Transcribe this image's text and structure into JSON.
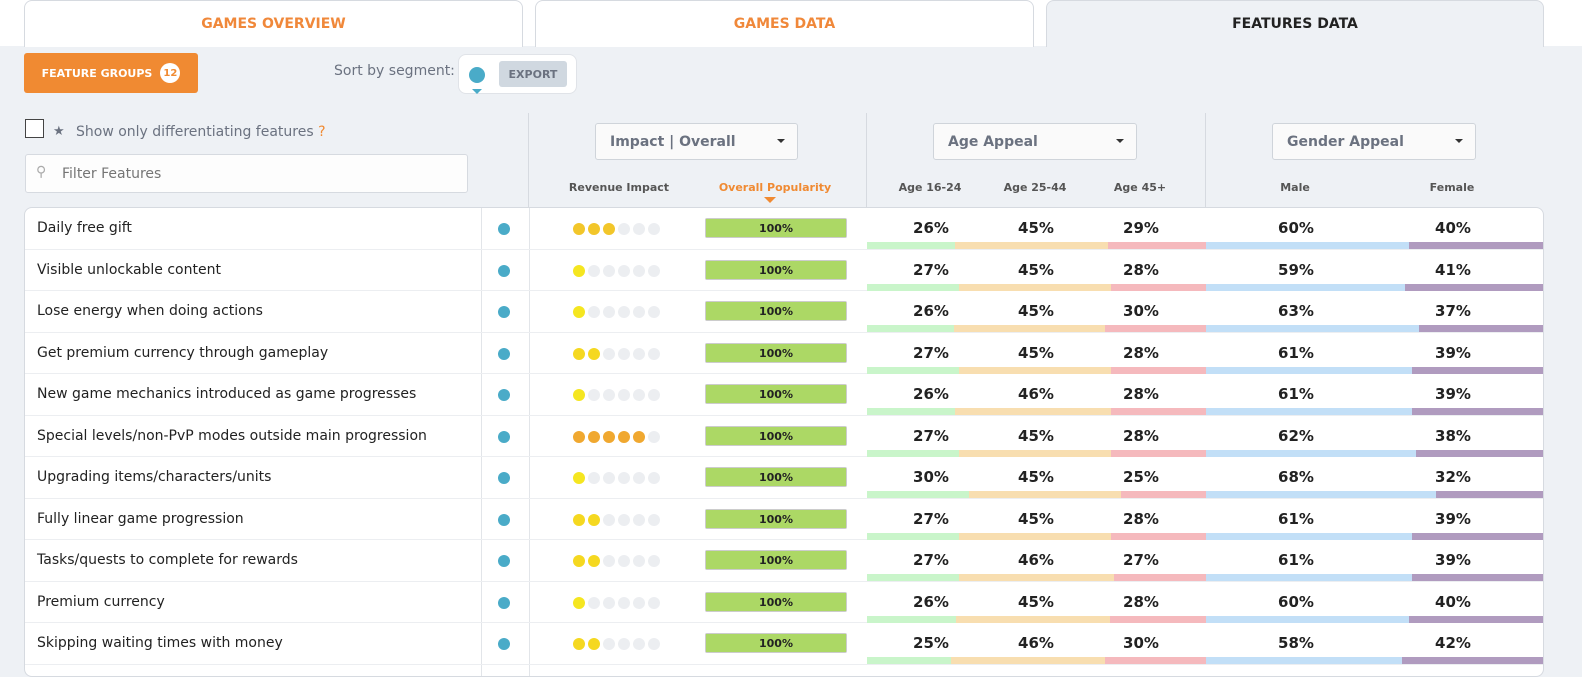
{
  "tabs": [
    {
      "label": "GAMES OVERVIEW"
    },
    {
      "label": "GAMES DATA"
    },
    {
      "label": "FEATURES DATA",
      "active": true
    }
  ],
  "toolbar": {
    "feature_groups_label": "FEATURE GROUPS",
    "feature_groups_count": "12",
    "sort_label": "Sort by segment:",
    "export_label": "EXPORT",
    "segment_color": "#4aabc8"
  },
  "filters": {
    "diff_label": "Show only differentiating features",
    "help": "?",
    "diff_checked": false,
    "search_placeholder": "Filter Features",
    "search_value": ""
  },
  "dropdowns": {
    "impact": "Impact | Overall",
    "age": "Age Appeal",
    "gender": "Gender Appeal"
  },
  "columns": {
    "revenue": "Revenue Impact",
    "popularity": "Overall Popularity",
    "age1": "Age 16-24",
    "age2": "Age 25-44",
    "age3": "Age 45+",
    "male": "Male",
    "female": "Female"
  },
  "colors": {
    "accent": "#f08a32",
    "popularity": "#acd865",
    "age1": "#c9f5ca",
    "age2": "#f8deb0",
    "age3": "#f5b9bd",
    "male": "#c2dff7",
    "female": "#b09bbf",
    "rev1": "#f5e620",
    "rev2": "#f5d820",
    "rev3": "#f2c62a",
    "rev5": "#f0a830"
  },
  "rows": [
    {
      "name": "Daily free gift",
      "revenue": 3,
      "popularity": "100%",
      "age": [
        "26%",
        "45%",
        "29%"
      ],
      "gender": [
        "60%",
        "40%"
      ]
    },
    {
      "name": "Visible unlockable content",
      "revenue": 1,
      "popularity": "100%",
      "age": [
        "27%",
        "45%",
        "28%"
      ],
      "gender": [
        "59%",
        "41%"
      ]
    },
    {
      "name": "Lose energy when doing actions",
      "revenue": 1,
      "popularity": "100%",
      "age": [
        "26%",
        "45%",
        "30%"
      ],
      "gender": [
        "63%",
        "37%"
      ]
    },
    {
      "name": "Get premium currency through gameplay",
      "revenue": 2,
      "popularity": "100%",
      "age": [
        "27%",
        "45%",
        "28%"
      ],
      "gender": [
        "61%",
        "39%"
      ]
    },
    {
      "name": "New game mechanics introduced as game progresses",
      "revenue": 1,
      "popularity": "100%",
      "age": [
        "26%",
        "46%",
        "28%"
      ],
      "gender": [
        "61%",
        "39%"
      ]
    },
    {
      "name": "Special levels/non-PvP modes outside main progression",
      "revenue": 5,
      "popularity": "100%",
      "age": [
        "27%",
        "45%",
        "28%"
      ],
      "gender": [
        "62%",
        "38%"
      ]
    },
    {
      "name": "Upgrading items/characters/units",
      "revenue": 1,
      "popularity": "100%",
      "age": [
        "30%",
        "45%",
        "25%"
      ],
      "gender": [
        "68%",
        "32%"
      ]
    },
    {
      "name": "Fully linear game progression",
      "revenue": 2,
      "popularity": "100%",
      "age": [
        "27%",
        "45%",
        "28%"
      ],
      "gender": [
        "61%",
        "39%"
      ]
    },
    {
      "name": "Tasks/quests to complete for rewards",
      "revenue": 2,
      "popularity": "100%",
      "age": [
        "27%",
        "46%",
        "27%"
      ],
      "gender": [
        "61%",
        "39%"
      ]
    },
    {
      "name": "Premium currency",
      "revenue": 1,
      "popularity": "100%",
      "age": [
        "26%",
        "45%",
        "28%"
      ],
      "gender": [
        "60%",
        "40%"
      ]
    },
    {
      "name": "Skipping waiting times with money",
      "revenue": 2,
      "popularity": "100%",
      "age": [
        "25%",
        "46%",
        "30%"
      ],
      "gender": [
        "58%",
        "42%"
      ]
    }
  ]
}
